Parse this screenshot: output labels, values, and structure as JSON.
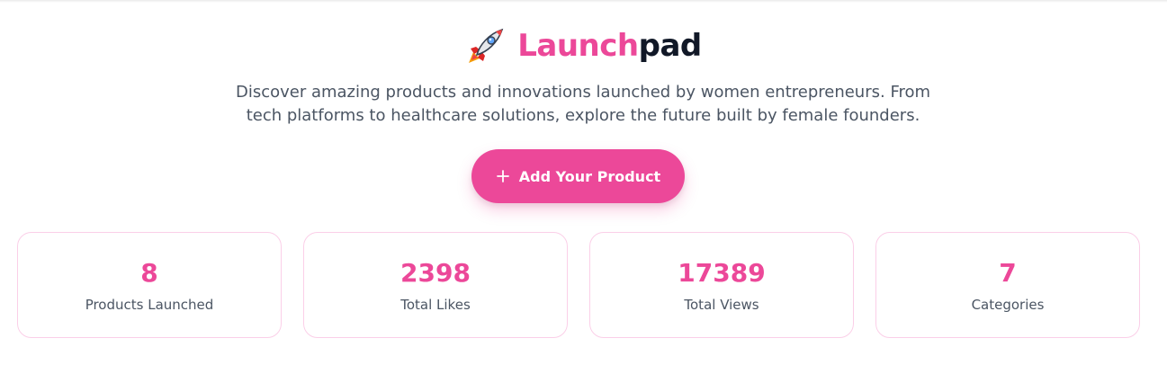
{
  "header": {
    "logo_icon": "rocket-icon",
    "brand_accent": "Launch",
    "brand_rest": "pad",
    "tagline": "Discover amazing products and innovations launched by women entrepreneurs. From tech platforms to healthcare solutions, explore the future built by female founders."
  },
  "cta": {
    "icon": "plus-icon",
    "label": "Add Your Product"
  },
  "stats": [
    {
      "value": "8",
      "label": "Products Launched"
    },
    {
      "value": "2398",
      "label": "Total Likes"
    },
    {
      "value": "17389",
      "label": "Total Views"
    },
    {
      "value": "7",
      "label": "Categories"
    }
  ],
  "colors": {
    "accent": "#ec4899",
    "text_dark": "#111827",
    "text_muted": "#4b5563",
    "card_border": "#fbcfe8"
  }
}
